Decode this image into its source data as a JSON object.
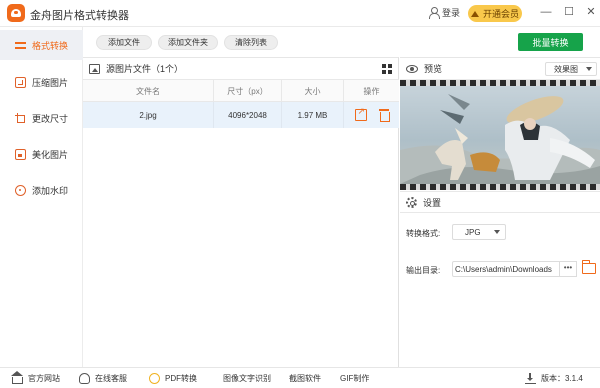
{
  "app": {
    "title": "金舟图片格式转换器",
    "login_label": "登录",
    "vip_label": "开通会员",
    "minimize_glyph": "—",
    "maximize_glyph": "☐",
    "close_glyph": "✕"
  },
  "sidebar": {
    "items": [
      {
        "label": "格式转换",
        "icon": "convert-icon",
        "active": true
      },
      {
        "label": "压缩图片",
        "icon": "compress-icon",
        "active": false
      },
      {
        "label": "更改尺寸",
        "icon": "resize-icon",
        "active": false
      },
      {
        "label": "美化图片",
        "icon": "beautify-icon",
        "active": false
      },
      {
        "label": "添加水印",
        "icon": "watermark-icon",
        "active": false
      }
    ]
  },
  "toolbar": {
    "add_file": "添加文件",
    "add_folder": "添加文件夹",
    "clear_list": "清除列表",
    "batch_convert": "批量转换"
  },
  "file_panel": {
    "header": "源图片文件（1个）",
    "columns": [
      "文件名",
      "尺寸（px）",
      "大小",
      "操作"
    ],
    "rows": [
      {
        "name": "2.jpg",
        "size_px": "4096*2048",
        "file_size": "1.97 MB"
      }
    ]
  },
  "preview": {
    "label": "预览",
    "effect_select": "效果图"
  },
  "settings": {
    "label": "设置",
    "format_label": "转换格式:",
    "format_value": "JPG",
    "output_label": "输出目录:",
    "output_path": "C:\\Users\\admin\\Downloads",
    "more_glyph": "•••"
  },
  "footer": {
    "website": "官方网站",
    "service": "在线客服",
    "pdf": "PDF转换",
    "ocr": "图像文字识别",
    "screenshot": "截图软件",
    "gif": "GIF制作",
    "version": "版本：3.1.4"
  },
  "colors": {
    "accent": "#f06a1b",
    "batch_button": "#16a34a",
    "vip_badge": "#f9c84b",
    "selected_row": "#e9f2fb"
  }
}
